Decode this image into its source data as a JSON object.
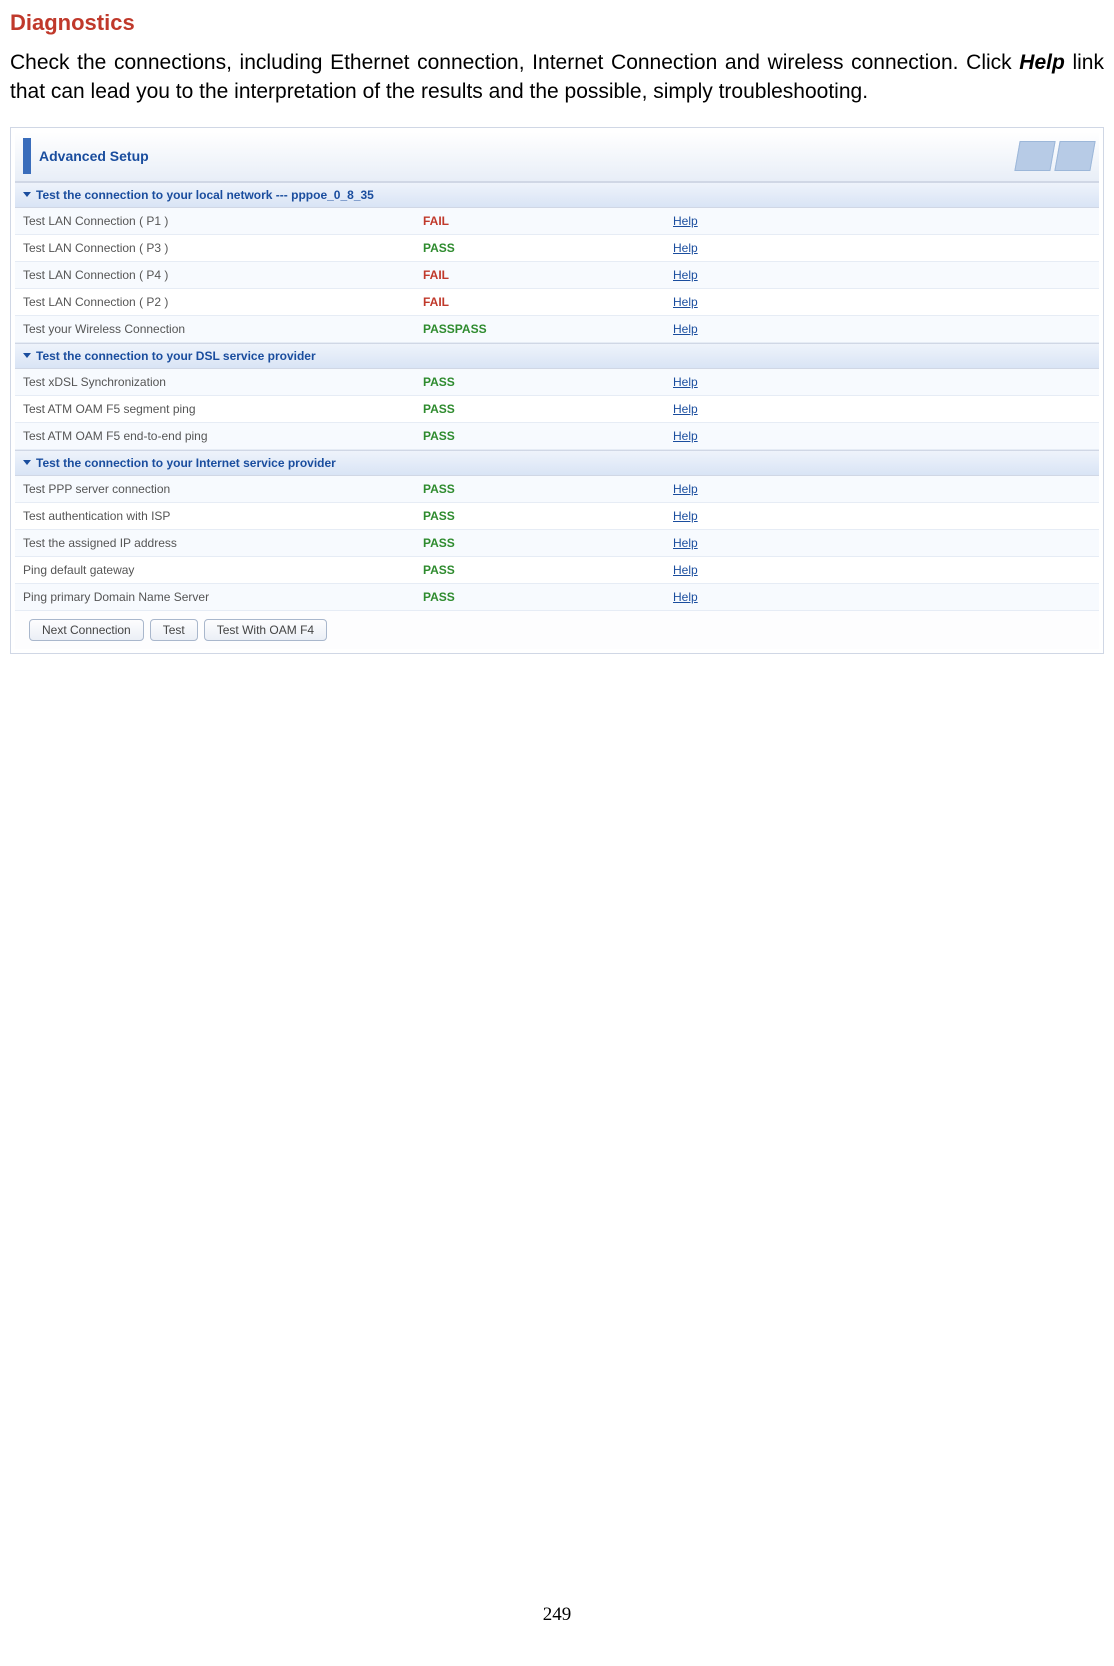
{
  "heading": "Diagnostics",
  "body_p1": "Check the connections, including Ethernet connection, Internet Connection and wireless connection.",
  "body_p2_a": "Click ",
  "body_p2_help": "Help",
  "body_p2_b": " link that can lead you to the interpretation of the results and the possible, simply troubleshooting.",
  "panel_title": "Advanced Setup",
  "sections": [
    {
      "title": "Test the connection to your local network --- pppoe_0_8_35",
      "rows": [
        {
          "name": "Test LAN Connection ( P1 )",
          "status": "FAIL",
          "cls": "fail",
          "help": "Help"
        },
        {
          "name": "Test LAN Connection ( P3 )",
          "status": "PASS",
          "cls": "pass",
          "help": "Help"
        },
        {
          "name": "Test LAN Connection ( P4 )",
          "status": "FAIL",
          "cls": "fail",
          "help": "Help"
        },
        {
          "name": "Test LAN Connection ( P2 )",
          "status": "FAIL",
          "cls": "fail",
          "help": "Help"
        },
        {
          "name": "Test your Wireless Connection",
          "status": "PASSPASS",
          "cls": "pass",
          "help": "Help"
        }
      ]
    },
    {
      "title": "Test the connection to your DSL service provider",
      "rows": [
        {
          "name": "Test xDSL Synchronization",
          "status": "PASS",
          "cls": "pass",
          "help": "Help"
        },
        {
          "name": "Test ATM OAM F5 segment ping",
          "status": "PASS",
          "cls": "pass",
          "help": "Help"
        },
        {
          "name": "Test ATM OAM F5 end-to-end ping",
          "status": "PASS",
          "cls": "pass",
          "help": "Help"
        }
      ]
    },
    {
      "title": "Test the connection to your Internet service provider",
      "rows": [
        {
          "name": "Test PPP server connection",
          "status": "PASS",
          "cls": "pass",
          "help": "Help"
        },
        {
          "name": "Test authentication with ISP",
          "status": "PASS",
          "cls": "pass",
          "help": "Help"
        },
        {
          "name": "Test the assigned IP address",
          "status": "PASS",
          "cls": "pass",
          "help": "Help"
        },
        {
          "name": "Ping default gateway",
          "status": "PASS",
          "cls": "pass",
          "help": "Help"
        },
        {
          "name": "Ping primary Domain Name Server",
          "status": "PASS",
          "cls": "pass",
          "help": "Help"
        }
      ]
    }
  ],
  "buttons": {
    "next_connection": "Next Connection",
    "test": "Test",
    "test_with_oam": "Test With OAM F4"
  },
  "page_number": "249"
}
